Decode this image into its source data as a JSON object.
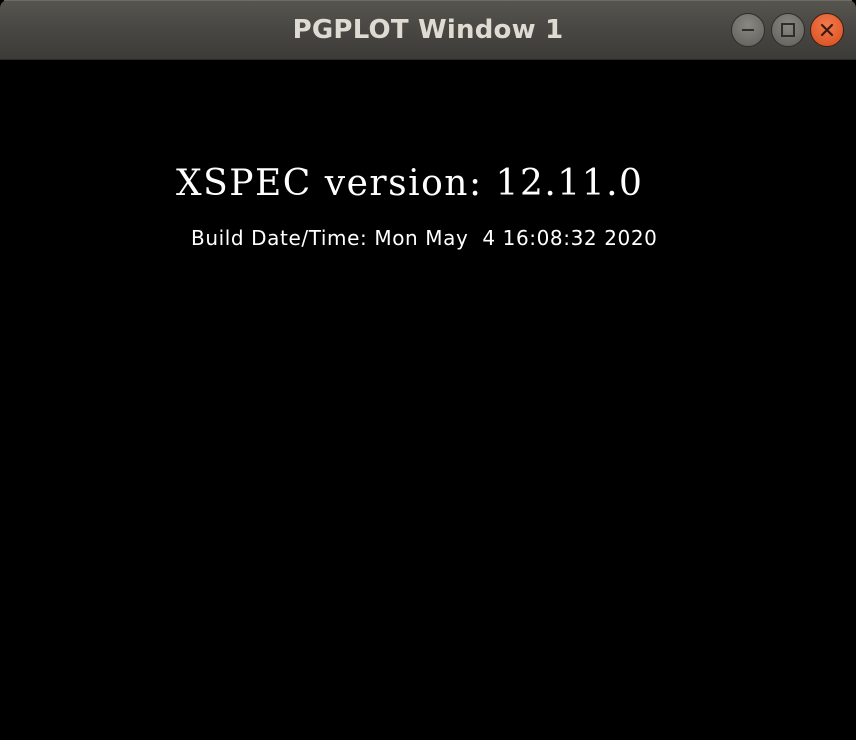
{
  "window": {
    "title": "PGPLOT Window 1",
    "controls": {
      "minimize_icon": "minimize-icon",
      "maximize_icon": "maximize-icon",
      "close_icon": "close-icon",
      "close_color": "#e05a2b",
      "button_color": "#6c6a65"
    }
  },
  "plot": {
    "background_color": "#000000",
    "text_color": "#ffffff",
    "version_line": "XSPEC version: 12.11.0",
    "build_line": "Build Date/Time: Mon May  4 16:08:32 2020"
  }
}
